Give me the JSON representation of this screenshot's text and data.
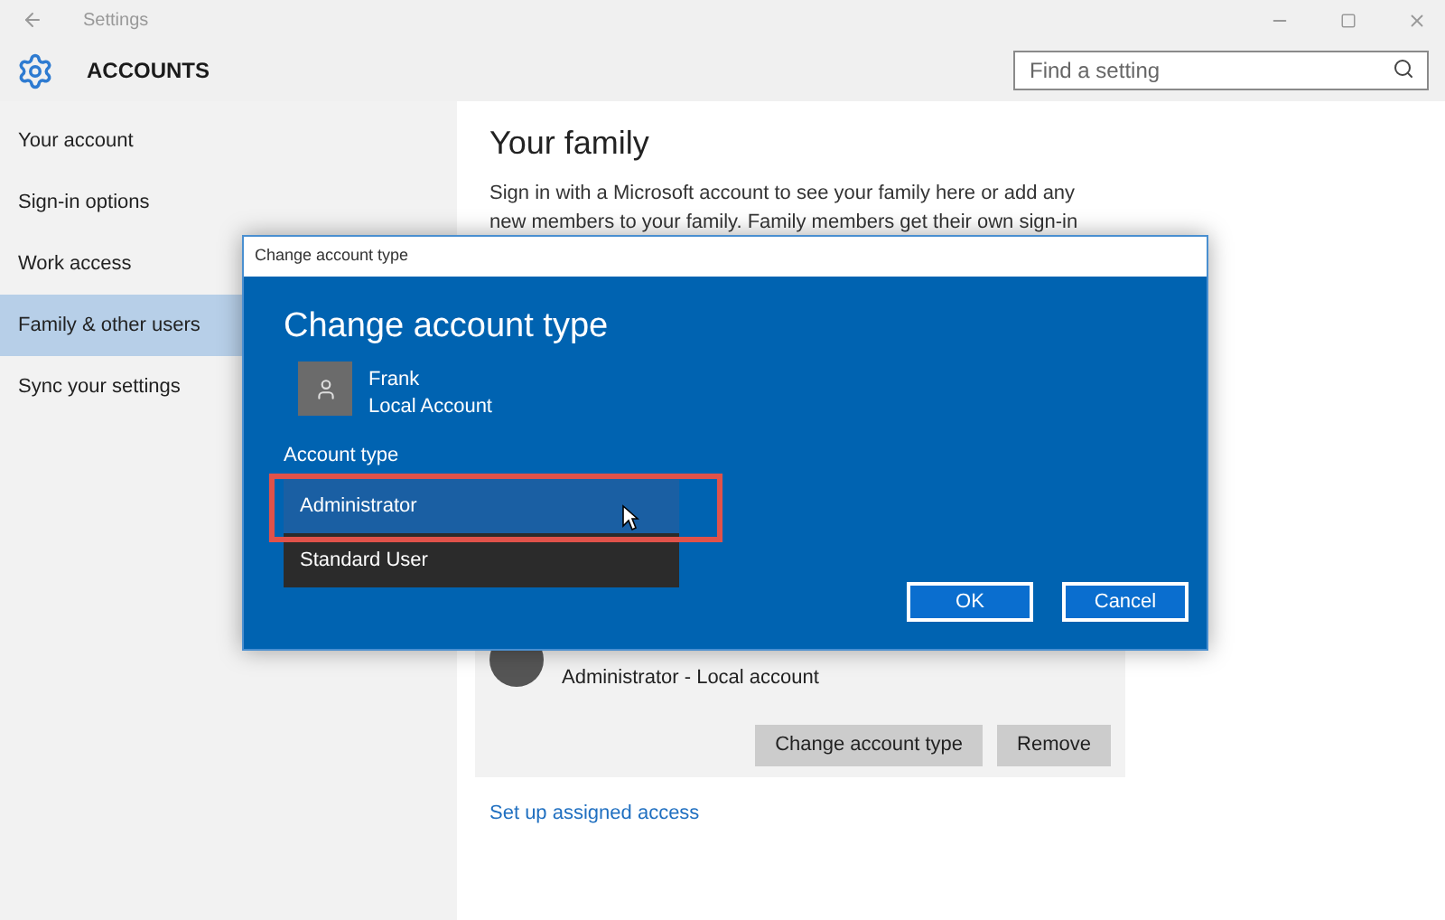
{
  "window": {
    "title": "Settings"
  },
  "header": {
    "title": "ACCOUNTS",
    "search": {
      "placeholder": "Find a setting"
    }
  },
  "sidebar": {
    "items": [
      {
        "label": "Your account",
        "selected": false
      },
      {
        "label": "Sign-in options",
        "selected": false
      },
      {
        "label": "Work access",
        "selected": false
      },
      {
        "label": "Family & other users",
        "selected": true
      },
      {
        "label": "Sync your settings",
        "selected": false
      }
    ]
  },
  "content": {
    "heading": "Your family",
    "paragraph_lines": [
      "Sign in with a Microsoft account to see your family here or add any",
      "new members to your family. Family members get their own sign-in"
    ],
    "account_card": {
      "subtitle": "Administrator - Local account",
      "buttons": [
        "Change account type",
        "Remove"
      ]
    },
    "link": "Set up assigned access"
  },
  "dialog": {
    "title": "Change account type",
    "heading": "Change account type",
    "user": {
      "name": "Frank",
      "type": "Local Account"
    },
    "field_label": "Account type",
    "options": [
      {
        "label": "Administrator",
        "selected": true
      },
      {
        "label": "Standard User",
        "selected": false
      }
    ],
    "buttons": [
      "OK",
      "Cancel"
    ]
  }
}
